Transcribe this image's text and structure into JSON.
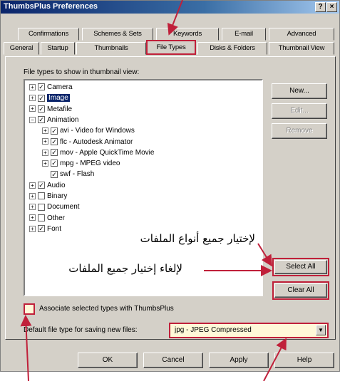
{
  "window": {
    "title": "ThumbsPlus Preferences",
    "help_button": "?",
    "close_button": "×"
  },
  "tabs": {
    "row1": [
      "Confirmations",
      "Schemes & Sets",
      "Keywords",
      "E-mail",
      "Advanced"
    ],
    "row2": [
      "General",
      "Startup",
      "Thumbnails",
      "File Types",
      "Disks & Folders",
      "Thumbnail View"
    ],
    "active": "File Types"
  },
  "panel": {
    "list_label": "File types to show in thumbnail view:",
    "tree": [
      {
        "label": "Camera",
        "expander": "+",
        "checked": true,
        "level": 0
      },
      {
        "label": "Image",
        "expander": "+",
        "checked": true,
        "level": 0,
        "selected": true
      },
      {
        "label": "Metafile",
        "expander": "+",
        "checked": true,
        "level": 0
      },
      {
        "label": "Animation",
        "expander": "−",
        "checked": true,
        "level": 0
      },
      {
        "label": "avi - Video for Windows",
        "expander": "+",
        "checked": true,
        "level": 1
      },
      {
        "label": "flc - Autodesk Animator",
        "expander": "+",
        "checked": true,
        "level": 1
      },
      {
        "label": "mov - Apple QuickTime Movie",
        "expander": "+",
        "checked": true,
        "level": 1
      },
      {
        "label": "mpg - MPEG video",
        "expander": "+",
        "checked": true,
        "level": 1
      },
      {
        "label": "swf - Flash",
        "expander": "",
        "checked": true,
        "level": 1
      },
      {
        "label": "Audio",
        "expander": "+",
        "checked": true,
        "level": 0
      },
      {
        "label": "Binary",
        "expander": "+",
        "checked": false,
        "level": 0
      },
      {
        "label": "Document",
        "expander": "+",
        "checked": false,
        "level": 0
      },
      {
        "label": "Other",
        "expander": "+",
        "checked": false,
        "level": 0
      },
      {
        "label": "Font",
        "expander": "+",
        "checked": true,
        "level": 0
      }
    ],
    "buttons": {
      "new": "New...",
      "edit": "Edit...",
      "remove": "Remove",
      "select_all": "Select All",
      "clear_all": "Clear All"
    },
    "associate_label": "Associate selected types with ThumbsPlus",
    "default_type_label": "Default file type for saving new files:",
    "default_type_value": "jpg - JPEG Compressed"
  },
  "dialog_buttons": {
    "ok": "OK",
    "cancel": "Cancel",
    "apply": "Apply",
    "help": "Help"
  },
  "annotations": {
    "select_all_callout": "لإختيار جميع أنواع الملفات",
    "clear_all_callout": "لإلغاء إختيار جميع الملفات",
    "arrow_color": "#c0203a",
    "highlight_color": "#c0203a"
  }
}
